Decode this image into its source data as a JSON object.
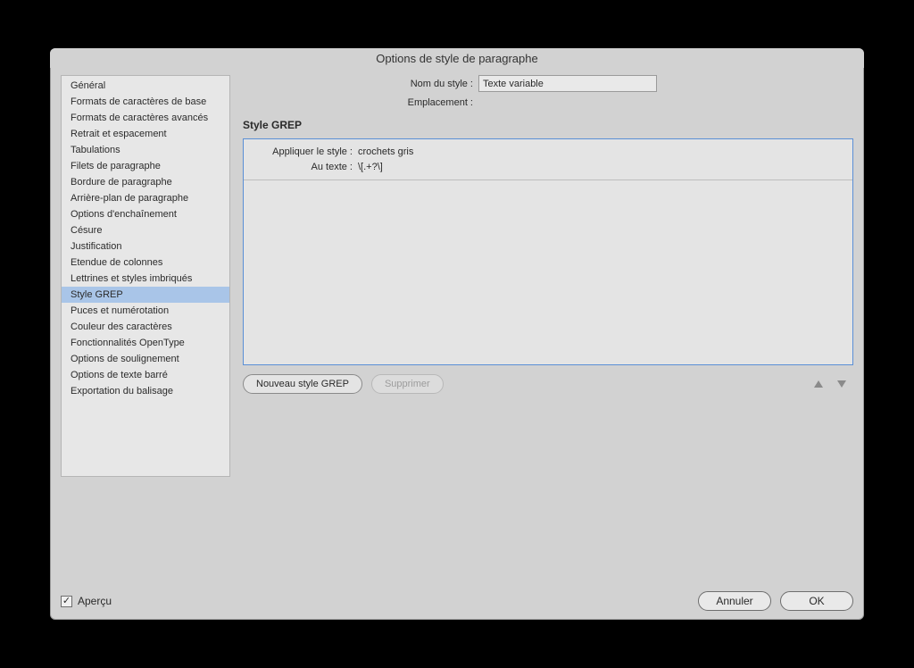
{
  "window": {
    "title": "Options de style de paragraphe"
  },
  "sidebar": {
    "items": [
      {
        "label": "Général",
        "selected": false
      },
      {
        "label": "Formats de caractères de base",
        "selected": false
      },
      {
        "label": "Formats de caractères avancés",
        "selected": false
      },
      {
        "label": "Retrait et espacement",
        "selected": false
      },
      {
        "label": "Tabulations",
        "selected": false
      },
      {
        "label": "Filets de paragraphe",
        "selected": false
      },
      {
        "label": "Bordure de paragraphe",
        "selected": false
      },
      {
        "label": "Arrière-plan de paragraphe",
        "selected": false
      },
      {
        "label": "Options d'enchaînement",
        "selected": false
      },
      {
        "label": "Césure",
        "selected": false
      },
      {
        "label": "Justification",
        "selected": false
      },
      {
        "label": "Etendue de colonnes",
        "selected": false
      },
      {
        "label": "Lettrines et styles imbriqués",
        "selected": false
      },
      {
        "label": "Style GREP",
        "selected": true
      },
      {
        "label": "Puces et numérotation",
        "selected": false
      },
      {
        "label": "Couleur des caractères",
        "selected": false
      },
      {
        "label": "Fonctionnalités OpenType",
        "selected": false
      },
      {
        "label": "Options de soulignement",
        "selected": false
      },
      {
        "label": "Options de texte barré",
        "selected": false
      },
      {
        "label": "Exportation du balisage",
        "selected": false
      }
    ]
  },
  "header": {
    "name_label": "Nom du style :",
    "name_value": "Texte variable",
    "location_label": "Emplacement :",
    "location_value": ""
  },
  "panel": {
    "title": "Style GREP",
    "entries": [
      {
        "apply_label": "Appliquer le style :",
        "apply_value": "crochets gris",
        "text_label": "Au texte :",
        "text_value": "\\[.+?\\]"
      }
    ],
    "buttons": {
      "new": "Nouveau style GREP",
      "delete": "Supprimer"
    }
  },
  "footer": {
    "preview_label": "Aperçu",
    "preview_checked": true,
    "cancel": "Annuler",
    "ok": "OK"
  }
}
